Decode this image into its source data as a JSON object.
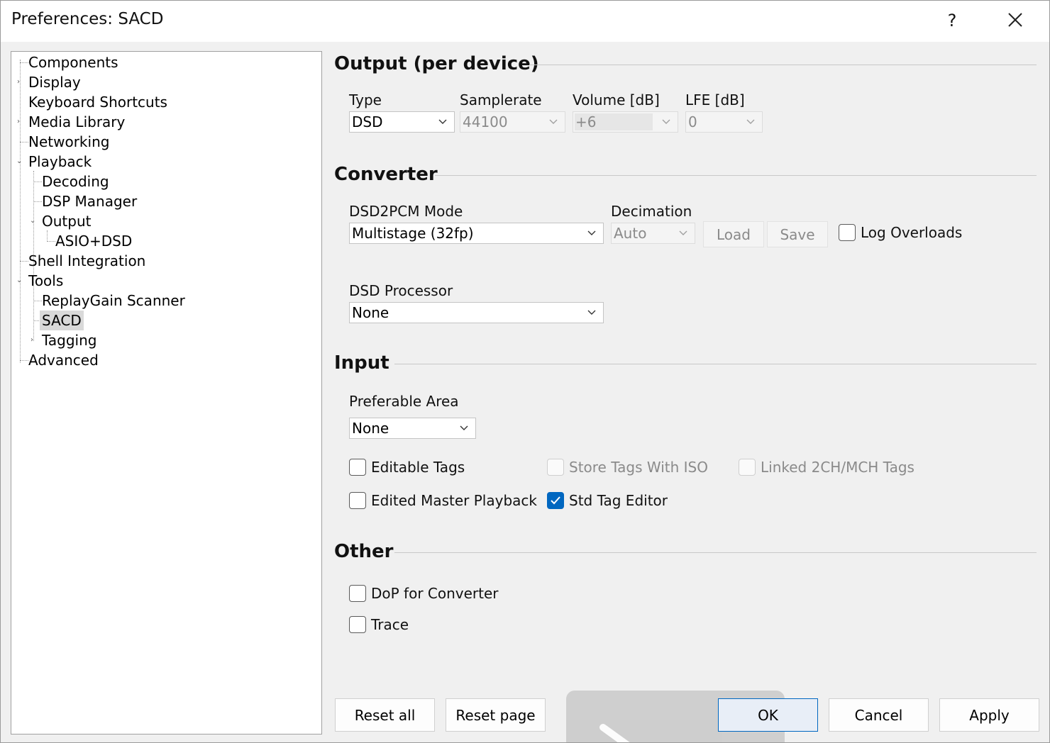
{
  "window": {
    "title": "Preferences: SACD",
    "help_label": "?"
  },
  "tree": {
    "components": "Components",
    "display": "Display",
    "keyboard_shortcuts": "Keyboard Shortcuts",
    "media_library": "Media Library",
    "networking": "Networking",
    "playback": "Playback",
    "decoding": "Decoding",
    "dsp_manager": "DSP Manager",
    "output": "Output",
    "asio_dsd": "ASIO+DSD",
    "shell_integration": "Shell Integration",
    "tools": "Tools",
    "replaygain_scanner": "ReplayGain Scanner",
    "sacd": "SACD",
    "tagging": "Tagging",
    "advanced": "Advanced"
  },
  "output": {
    "title": "Output (per device)",
    "type_label": "Type",
    "type_value": "DSD",
    "samplerate_label": "Samplerate",
    "samplerate_value": "44100",
    "volume_label": "Volume [dB]",
    "volume_value": "+6",
    "lfe_label": "LFE [dB]",
    "lfe_value": "0"
  },
  "converter": {
    "title": "Converter",
    "mode_label": "DSD2PCM Mode",
    "mode_value": "Multistage (32fp)",
    "decimation_label": "Decimation",
    "decimation_value": "Auto",
    "load_label": "Load",
    "save_label": "Save",
    "log_overloads_label": "Log Overloads",
    "log_overloads_checked": false,
    "processor_label": "DSD Processor",
    "processor_value": "None"
  },
  "input": {
    "title": "Input",
    "area_label": "Preferable Area",
    "area_value": "None",
    "editable_tags": {
      "label": "Editable Tags",
      "checked": false
    },
    "store_tags_iso": {
      "label": "Store Tags With ISO",
      "checked": false
    },
    "linked_tags": {
      "label": "Linked 2CH/MCH Tags",
      "checked": false
    },
    "edited_master": {
      "label": "Edited Master Playback",
      "checked": false
    },
    "std_tag_editor": {
      "label": "Std Tag Editor",
      "checked": true
    }
  },
  "other": {
    "title": "Other",
    "dop": {
      "label": "DoP for Converter",
      "checked": false
    },
    "trace": {
      "label": "Trace",
      "checked": false
    }
  },
  "footer": {
    "reset_all": "Reset all",
    "reset_page": "Reset page",
    "ok": "OK",
    "cancel": "Cancel",
    "apply": "Apply"
  },
  "colors": {
    "accent": "#0067c0",
    "panel": "#f0f0f0",
    "selection": "#d9d9d9"
  },
  "icons": {
    "close": "close-icon",
    "help": "help-icon",
    "dropdown": "chevron-down-icon",
    "check": "check-icon"
  }
}
